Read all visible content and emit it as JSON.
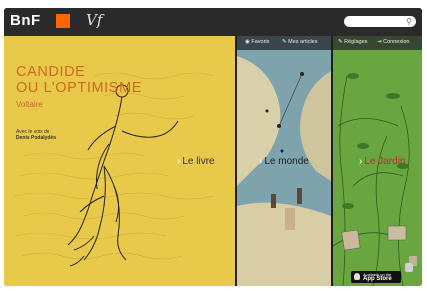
{
  "header": {
    "brand": "BnF",
    "vf_logo": "Vf",
    "search_placeholder": ""
  },
  "toolbar": {
    "favoris": "Favoris",
    "mes_articles": "Mes articles",
    "reglages": "Réglages",
    "connexion": "Connexion"
  },
  "book": {
    "title_line1": "CANDIDE",
    "title_line2": "OU L’OPTIMISME",
    "author": "Voltaire",
    "preface_line1": "Avec le voix de",
    "preface_line2": "Denis Podalydès"
  },
  "sections": {
    "livre": "Le livre",
    "monde": "Le monde",
    "jardin": "Le Jardin"
  },
  "appstore": {
    "line1": "Available on the",
    "line2": "App Store"
  },
  "colors": {
    "livre_bg": "#e9c94a",
    "monde_bg": "#5c7f8a",
    "jardin_bg": "#6aa640",
    "title_color": "#d2691e",
    "orange_logo": "#ff6600"
  }
}
